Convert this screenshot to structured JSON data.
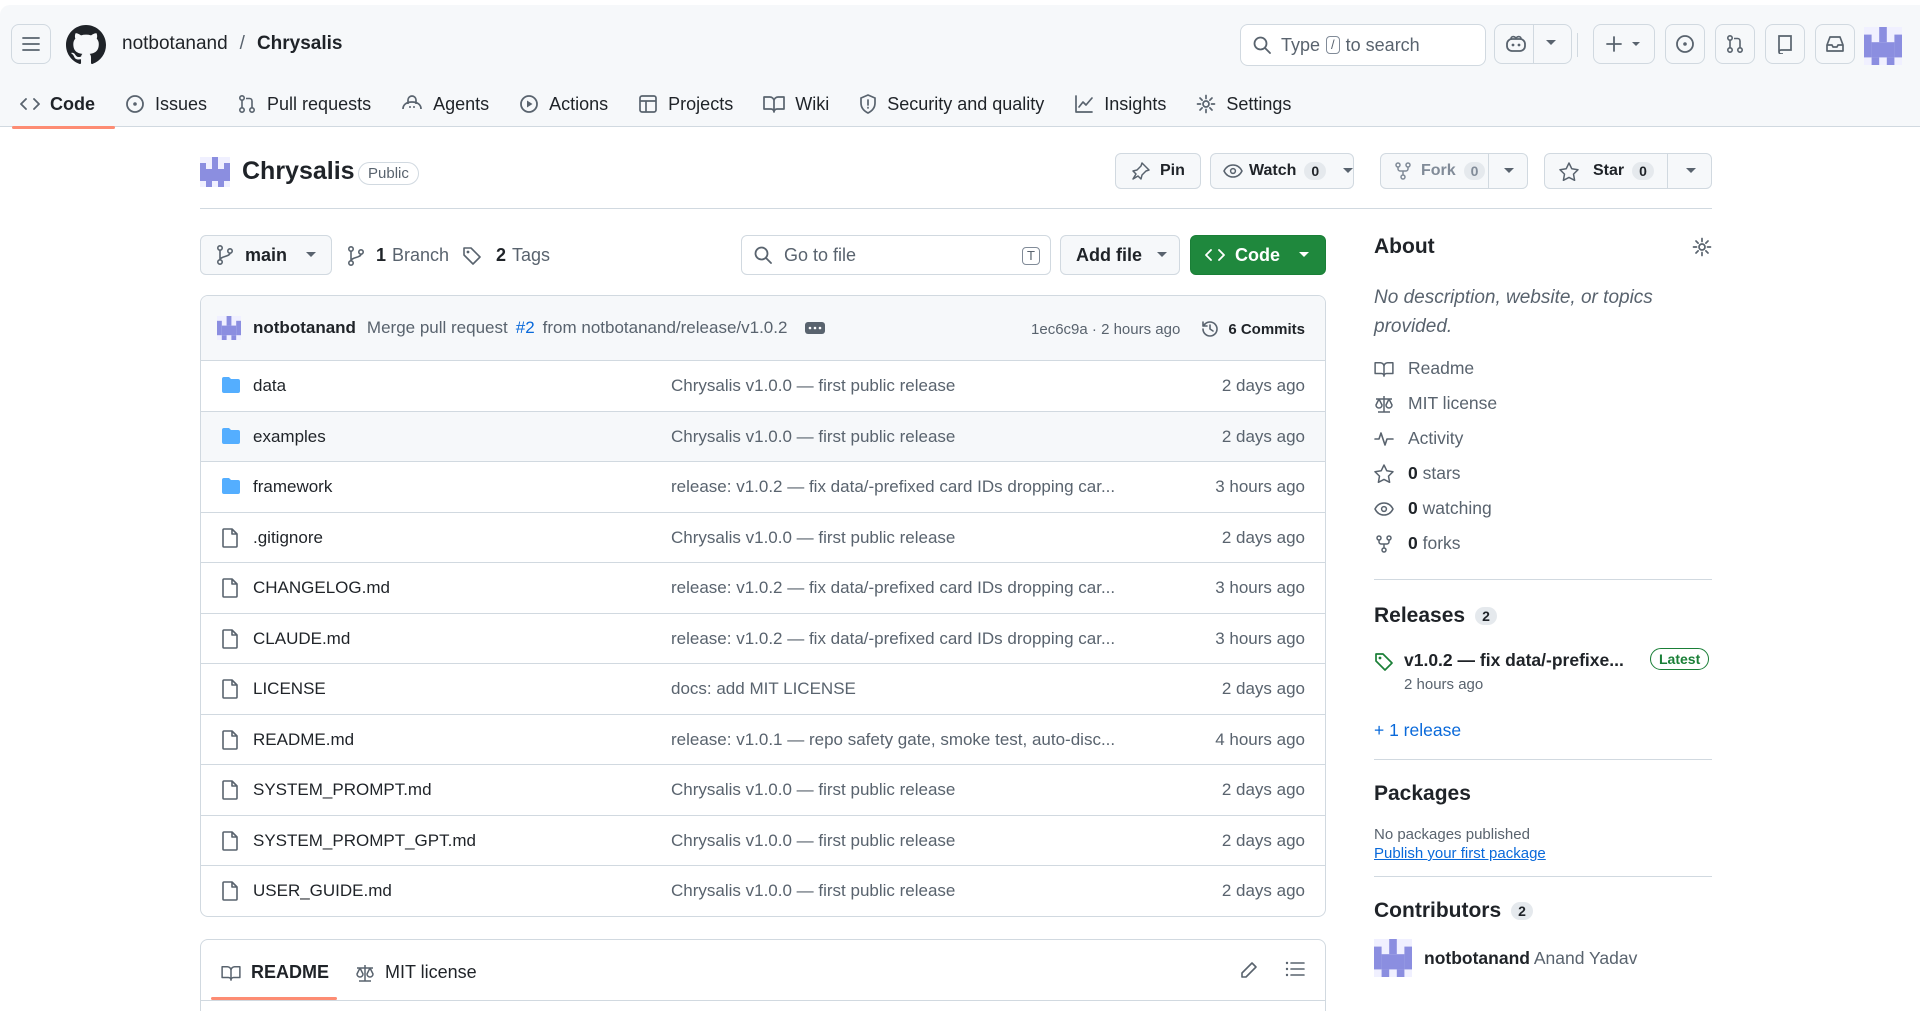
{
  "header": {
    "owner": "notbotanand",
    "separator": "/",
    "repo": "Chrysalis",
    "search_prefix": "Type",
    "search_key": "/",
    "search_suffix": "to search"
  },
  "tabs": [
    {
      "label": "Code"
    },
    {
      "label": "Issues"
    },
    {
      "label": "Pull requests"
    },
    {
      "label": "Agents"
    },
    {
      "label": "Actions"
    },
    {
      "label": "Projects"
    },
    {
      "label": "Wiki"
    },
    {
      "label": "Security and quality"
    },
    {
      "label": "Insights"
    },
    {
      "label": "Settings"
    }
  ],
  "repohead": {
    "name": "Chrysalis",
    "visibility": "Public",
    "pin_label": "Pin",
    "watch_label": "Watch",
    "watch_count": "0",
    "fork_label": "Fork",
    "fork_count": "0",
    "star_label": "Star",
    "star_count": "0"
  },
  "toolbar": {
    "branch": "main",
    "branches_count": "1",
    "branches_label": "Branch",
    "tags_count": "2",
    "tags_label": "Tags",
    "goto_placeholder": "Go to file",
    "goto_key": "T",
    "add_file": "Add file",
    "code": "Code"
  },
  "commit": {
    "author": "notbotanand",
    "message_pre": "Merge pull request",
    "pr": "#2",
    "message_post": "from notbotanand/release/v1.0.2",
    "sha_time": "1ec6c9a · 2 hours ago",
    "commits": "6 Commits"
  },
  "files": [
    {
      "name": "data",
      "type": "dir",
      "message": "Chrysalis v1.0.0 — first public release",
      "age": "2 days ago"
    },
    {
      "name": "examples",
      "type": "dir",
      "message": "Chrysalis v1.0.0 — first public release",
      "age": "2 days ago"
    },
    {
      "name": "framework",
      "type": "dir",
      "message": "release: v1.0.2 — fix data/-prefixed card IDs dropping car...",
      "age": "3 hours ago"
    },
    {
      "name": ".gitignore",
      "type": "file",
      "message": "Chrysalis v1.0.0 — first public release",
      "age": "2 days ago"
    },
    {
      "name": "CHANGELOG.md",
      "type": "file",
      "message": "release: v1.0.2 — fix data/-prefixed card IDs dropping car...",
      "age": "3 hours ago"
    },
    {
      "name": "CLAUDE.md",
      "type": "file",
      "message": "release: v1.0.2 — fix data/-prefixed card IDs dropping car...",
      "age": "3 hours ago"
    },
    {
      "name": "LICENSE",
      "type": "file",
      "message": "docs: add MIT LICENSE",
      "age": "2 days ago"
    },
    {
      "name": "README.md",
      "type": "file",
      "message": "release: v1.0.1 — repo safety gate, smoke test, auto-disc...",
      "age": "4 hours ago"
    },
    {
      "name": "SYSTEM_PROMPT.md",
      "type": "file",
      "message": "Chrysalis v1.0.0 — first public release",
      "age": "2 days ago"
    },
    {
      "name": "SYSTEM_PROMPT_GPT.md",
      "type": "file",
      "message": "Chrysalis v1.0.0 — first public release",
      "age": "2 days ago"
    },
    {
      "name": "USER_GUIDE.md",
      "type": "file",
      "message": "Chrysalis v1.0.0 — first public release",
      "age": "2 days ago"
    }
  ],
  "readme_tabs": {
    "readme": "README",
    "license": "MIT license"
  },
  "about": {
    "title": "About",
    "description": "No description, website, or topics provided.",
    "readme": "Readme",
    "license": "MIT license",
    "activity": "Activity",
    "stars_count": "0",
    "stars_label": "stars",
    "watching_count": "0",
    "watching_label": "watching",
    "forks_count": "0",
    "forks_label": "forks"
  },
  "releases": {
    "title": "Releases",
    "count": "2",
    "latest_name": "v1.0.2 — fix data/-prefixe...",
    "latest_badge": "Latest",
    "latest_time": "2 hours ago",
    "more": "+ 1 release"
  },
  "packages": {
    "title": "Packages",
    "none": "No packages published",
    "publish": "Publish your first package"
  },
  "contributors": {
    "title": "Contributors",
    "count": "2",
    "login": "notbotanand",
    "name": "Anand Yadav"
  },
  "colors": {
    "accent_underline": "#fd8c73",
    "code_button": "#1f883d",
    "folder": "#54aeff",
    "link": "#0969da",
    "avatar": "#8b8ee0"
  }
}
